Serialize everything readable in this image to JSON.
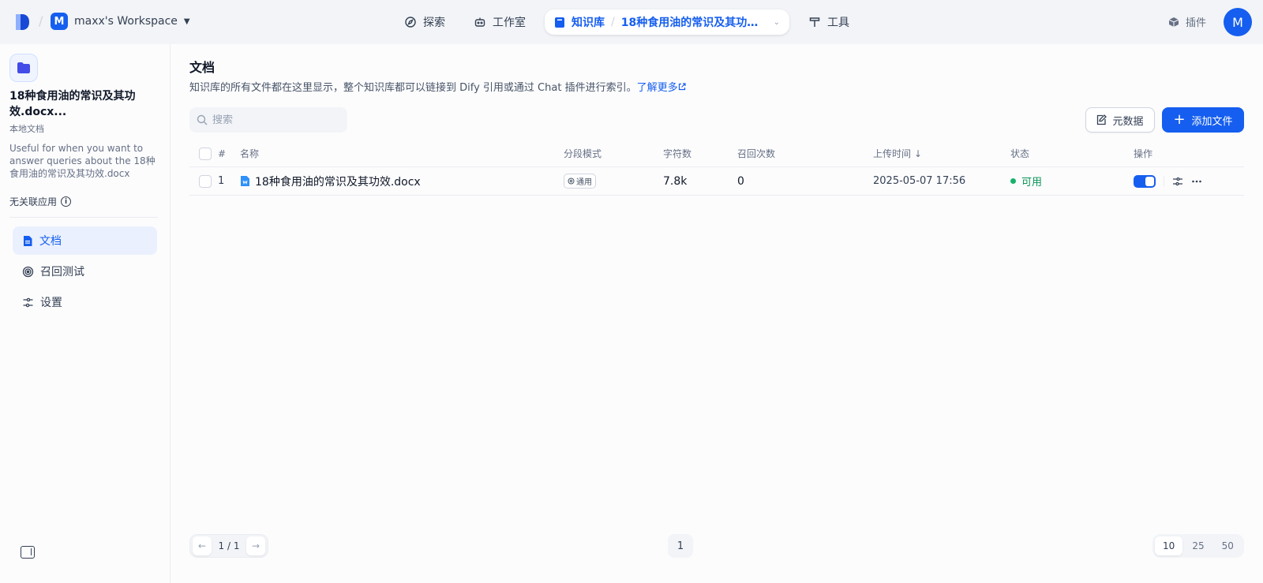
{
  "topbar": {
    "workspace": {
      "avatar": "M",
      "name": "maxx's Workspace"
    },
    "nav": {
      "explore": "探索",
      "studio": "工作室",
      "knowledge": "知识库",
      "current_dataset": "18种食用油的常识及其功效.docx",
      "tools": "工具"
    },
    "plugins": "插件",
    "user_avatar": "M",
    "colors": {
      "accent": "#155eef"
    }
  },
  "sidebar": {
    "dataset_title": "18种食用油的常识及其功效.docx...",
    "dataset_type": "本地文档",
    "description": "Useful for when you want to answer queries about the 18种食用油的常识及其功效.docx",
    "linked_apps": "无关联应用",
    "menu": [
      {
        "label": "文档",
        "icon": "document-icon",
        "active": true
      },
      {
        "label": "召回测试",
        "icon": "target-icon",
        "active": false
      },
      {
        "label": "设置",
        "icon": "settings-icon",
        "active": false
      }
    ]
  },
  "main": {
    "title": "文档",
    "description": "知识库的所有文件都在这里显示，整个知识库都可以链接到 Dify 引用或通过 Chat 插件进行索引。",
    "learn_more": "了解更多",
    "search_placeholder": "搜索",
    "metadata_button": "元数据",
    "add_file_button": "添加文件",
    "table": {
      "headers": {
        "num": "#",
        "name": "名称",
        "mode": "分段模式",
        "words": "字符数",
        "hits": "召回次数",
        "uploaded": "上传时间",
        "status": "状态",
        "actions": "操作"
      },
      "sort_indicator": "↓",
      "rows": [
        {
          "num": "1",
          "name": "18种食用油的常识及其功效.docx",
          "mode": "通用",
          "words": "7.8k",
          "hits": "0",
          "uploaded": "2025-05-07 17:56",
          "status": "可用",
          "enabled": true
        }
      ]
    },
    "pagination": {
      "page_indicator": "1 / 1",
      "current_page": "1",
      "page_sizes": [
        "10",
        "25",
        "50"
      ],
      "selected_size": "10"
    }
  }
}
